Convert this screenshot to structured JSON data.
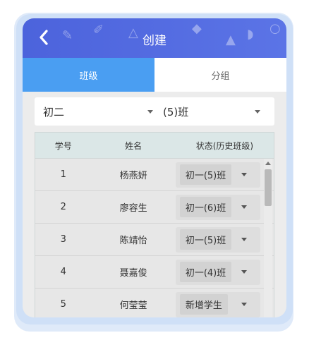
{
  "header": {
    "title": "创建"
  },
  "tabs": [
    {
      "label": "班级",
      "active": true
    },
    {
      "label": "分组",
      "active": false
    }
  ],
  "selectors": {
    "grade": "初二",
    "class": "(5)班"
  },
  "table": {
    "columns": [
      "学号",
      "姓名",
      "状态(历史班级)"
    ],
    "rows": [
      {
        "no": "1",
        "name": "杨燕妍",
        "status": "初一(5)班"
      },
      {
        "no": "2",
        "name": "廖容生",
        "status": "初一(6)班"
      },
      {
        "no": "3",
        "name": "陈靖怡",
        "status": "初一(5)班"
      },
      {
        "no": "4",
        "name": "聂嘉俊",
        "status": "初一(4)班"
      },
      {
        "no": "5",
        "name": "何莹莹",
        "status": "新增学生"
      }
    ]
  },
  "colors": {
    "header": "#5066df",
    "active_tab": "#4a9ef2",
    "frame": "#cfe0f7"
  },
  "icons": {
    "back": "chevron-left-icon"
  }
}
